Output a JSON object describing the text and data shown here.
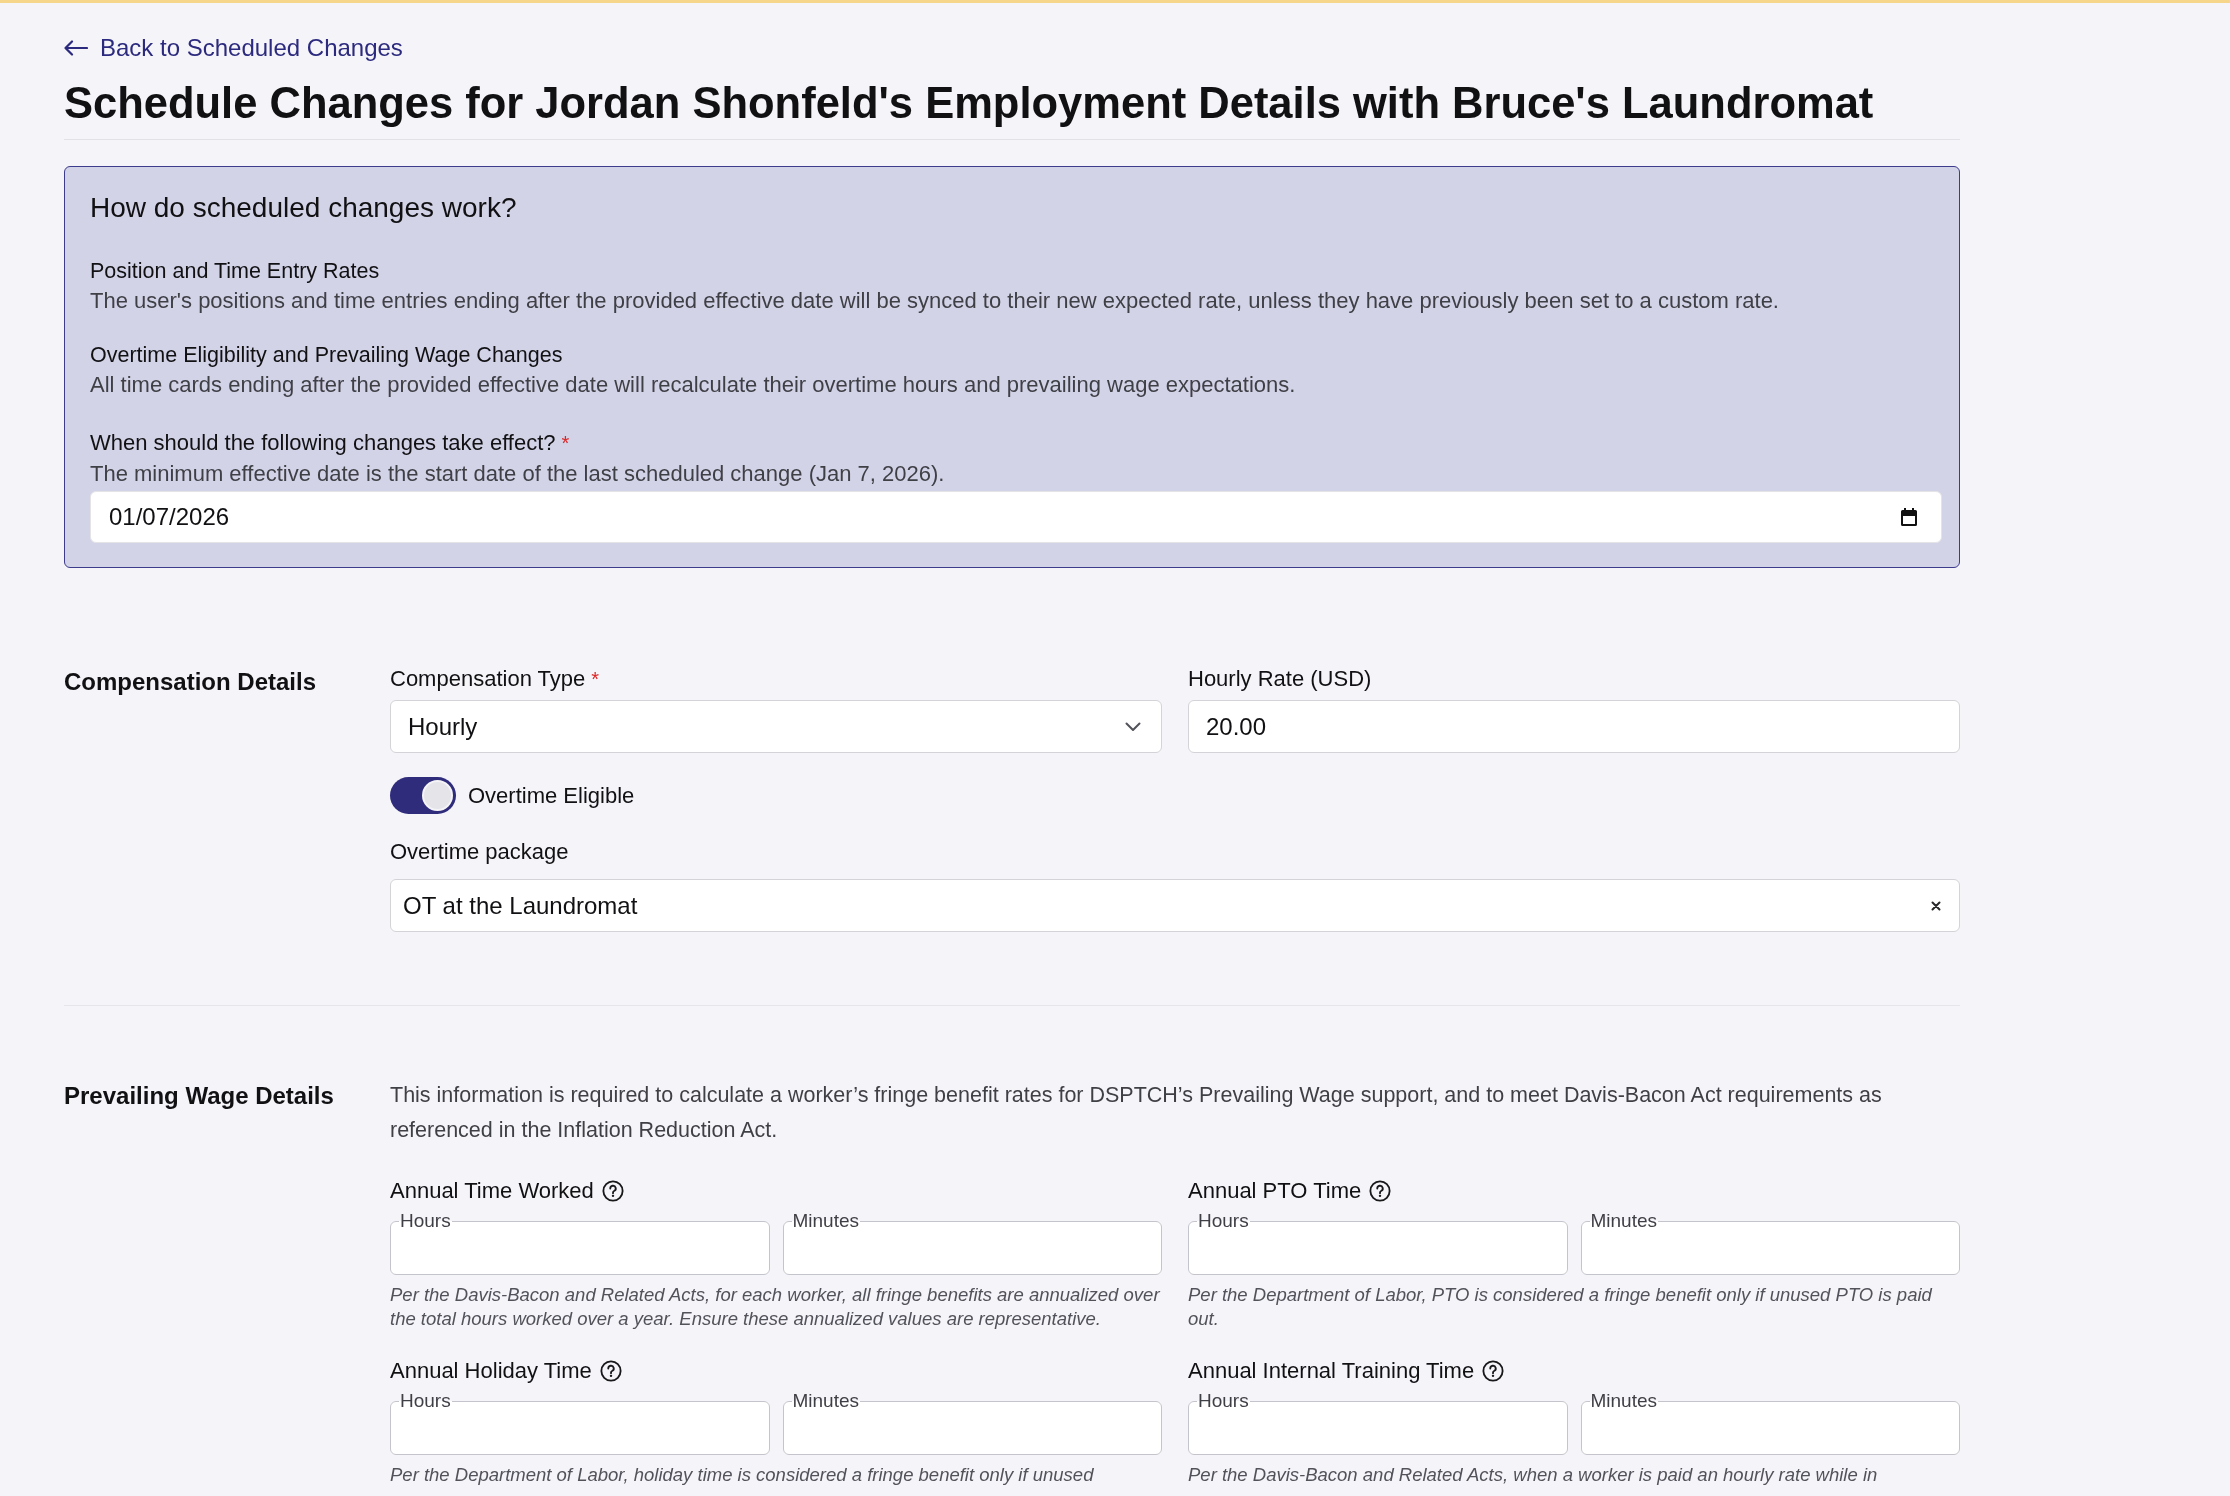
{
  "back_link": {
    "label": "Back to Scheduled Changes"
  },
  "page_title": "Schedule Changes for Jordan Shonfeld's Employment Details with Bruce's Laundromat",
  "info_panel": {
    "title": "How do scheduled changes work?",
    "sections": [
      {
        "heading": "Position and Time Entry Rates",
        "text": "The user's positions and time entries ending after the provided effective date will be synced to their new expected rate, unless they have previously been set to a custom rate."
      },
      {
        "heading": "Overtime Eligibility and Prevailing Wage Changes",
        "text": "All time cards ending after the provided effective date will recalculate their overtime hours and prevailing wage expectations."
      }
    ],
    "effective_date": {
      "label": "When should the following changes take effect?",
      "required_mark": "*",
      "help": "The minimum effective date is the start date of the last scheduled change (Jan 7, 2026).",
      "value": "01/07/2026"
    }
  },
  "compensation": {
    "title": "Compensation Details",
    "compensation_type": {
      "label": "Compensation Type",
      "required_mark": "*",
      "value": "Hourly"
    },
    "hourly_rate": {
      "label": "Hourly Rate (USD)",
      "value": "20.00"
    },
    "overtime_eligible": {
      "label": "Overtime Eligible",
      "on": true
    },
    "overtime_package": {
      "label": "Overtime package",
      "value": "OT at the Laundromat"
    }
  },
  "prevailing_wage": {
    "title": "Prevailing Wage Details",
    "description": "This information is required to calculate a worker’s fringe benefit rates for DSPTCH’s Prevailing Wage support, and to meet Davis-Bacon Act requirements as referenced in the Inflation Reduction Act.",
    "groups": [
      {
        "label": "Annual Time Worked",
        "fields": [
          {
            "legend": "Hours"
          },
          {
            "legend": "Minutes"
          }
        ],
        "note": "Per the Davis-Bacon and Related Acts, for each worker, all fringe benefits are annualized over the total hours worked over a year. Ensure these annualized values are representative."
      },
      {
        "label": "Annual PTO Time",
        "fields": [
          {
            "legend": "Hours"
          },
          {
            "legend": "Minutes"
          }
        ],
        "note": "Per the Department of Labor, PTO is considered a fringe benefit only if unused PTO is paid out."
      },
      {
        "label": "Annual Holiday Time",
        "fields": [
          {
            "legend": "Hours"
          },
          {
            "legend": "Minutes"
          }
        ],
        "note": "Per the Department of Labor, holiday time is considered a fringe benefit only if unused"
      },
      {
        "label": "Annual Internal Training Time",
        "fields": [
          {
            "legend": "Hours"
          },
          {
            "legend": "Minutes"
          }
        ],
        "note": "Per the Davis-Bacon and Related Acts, when a worker is paid an hourly rate while in"
      }
    ]
  }
}
